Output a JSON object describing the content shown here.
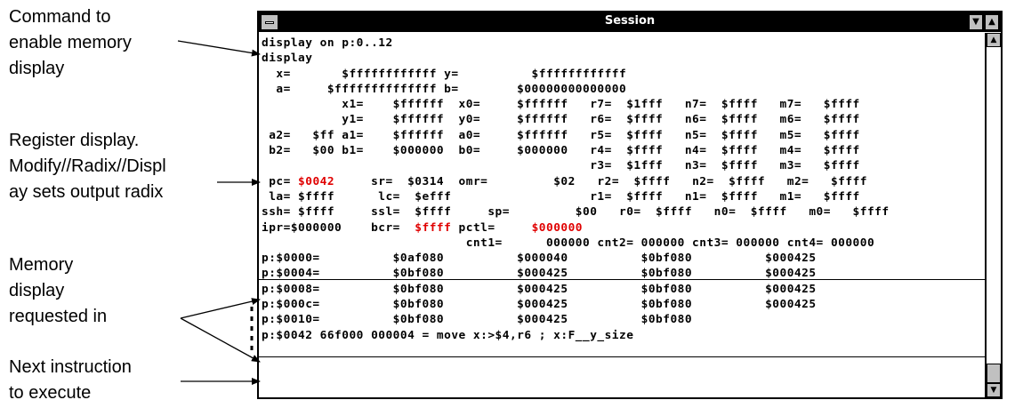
{
  "window": {
    "title": "Session",
    "minimize_glyph": "▼",
    "maximize_glyph": "▲",
    "scroll_up_glyph": "▲",
    "scroll_down_glyph": "▼"
  },
  "annotations": {
    "command": [
      "Command to",
      "enable memory",
      "display"
    ],
    "register": [
      "Register display.",
      "Modify//Radix//Displ",
      "ay sets output radix"
    ],
    "memory": [
      "Memory",
      "display",
      "requested in"
    ],
    "next": [
      "Next instruction",
      "to execute"
    ]
  },
  "session": {
    "lines": [
      [
        {
          "t": "display on p:0..12"
        }
      ],
      [
        {
          "t": "display"
        }
      ],
      [
        {
          "t": "  x=       $ffffffffffff y=          $ffffffffffff"
        }
      ],
      [
        {
          "t": "  a=     $ffffffffffffff b=        $00000000000000"
        }
      ],
      [
        {
          "t": "           x1=    $ffffff  x0=     $ffffff   r7=  $1fff   n7=  $ffff   m7=   $ffff"
        }
      ],
      [
        {
          "t": "           y1=    $ffffff  y0=     $ffffff   r6=  $ffff   n6=  $ffff   m6=   $ffff"
        }
      ],
      [
        {
          "t": " a2=   $ff a1=    $ffffff  a0=     $ffffff   r5=  $ffff   n5=  $ffff   m5=   $ffff"
        }
      ],
      [
        {
          "t": " b2=   $00 b1=    $000000  b0=     $000000   r4=  $ffff   n4=  $ffff   m4=   $ffff"
        }
      ],
      [
        {
          "t": "                                             r3=  $1fff   n3=  $ffff   m3=   $ffff"
        }
      ],
      [
        {
          "t": " pc= "
        },
        {
          "t": "$0042",
          "red": true
        },
        {
          "t": "     sr=  $0314  omr=         $02   r2=  $ffff   n2=  $ffff   m2=   $ffff"
        }
      ],
      [
        {
          "t": " la= $ffff      lc=  $efff                   r1=  $ffff   n1=  $ffff   m1=   $ffff"
        }
      ],
      [
        {
          "t": "ssh= $ffff     ssl=  $ffff     sp=         $00   r0=  $ffff   n0=  $ffff   m0=   $ffff"
        }
      ],
      [
        {
          "t": "ipr=$000000    bcr=  "
        },
        {
          "t": "$ffff",
          "red": true
        },
        {
          "t": " pctl=     "
        },
        {
          "t": "$000000",
          "red": true
        }
      ],
      [
        {
          "t": "                            cnt1=      000000 cnt2= 000000 cnt3= 000000 cnt4= 000000"
        }
      ],
      [
        {
          "t": "p:$0000=          $0af080          $000040          $0bf080          $000425"
        }
      ],
      [
        {
          "t": "p:$0004=          $0bf080          $000425          $0bf080          $000425"
        }
      ],
      [
        {
          "t": "p:$0008=          $0bf080          $000425          $0bf080          $000425"
        }
      ],
      [
        {
          "t": "p:$000c=          $0bf080          $000425          $0bf080          $000425"
        }
      ],
      [
        {
          "t": "p:$0010=          $0bf080          $000425          $0bf080"
        }
      ],
      [
        {
          "t": "p:$0042 66f000 000004 = move x:>$4,r6 ; x:F__y_size"
        }
      ]
    ]
  }
}
